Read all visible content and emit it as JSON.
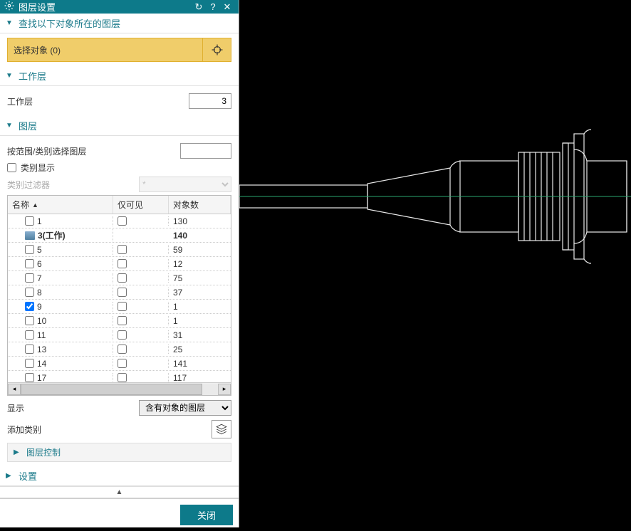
{
  "title_bar": {
    "title": "图层设置"
  },
  "sections": {
    "find": {
      "title": "查找以下对象所在的图层",
      "select_label": "选择对象 (0)"
    },
    "work_layer": {
      "title": "工作层",
      "label": "工作层",
      "value": "3"
    },
    "layers": {
      "title": "图层",
      "range_label": "按范围/类别选择图层",
      "range_value": "",
      "category_display_label": "类别显示",
      "category_filter_label": "类别过滤器",
      "category_filter_value": "*",
      "col_name": "名称",
      "col_visible": "仅可见",
      "col_objects": "对象数",
      "rows": [
        {
          "name": "1",
          "objects": "130",
          "checked": false,
          "work": false
        },
        {
          "name": "3(工作)",
          "objects": "140",
          "checked": false,
          "work": true
        },
        {
          "name": "5",
          "objects": "59",
          "checked": false,
          "work": false
        },
        {
          "name": "6",
          "objects": "12",
          "checked": false,
          "work": false
        },
        {
          "name": "7",
          "objects": "75",
          "checked": false,
          "work": false
        },
        {
          "name": "8",
          "objects": "37",
          "checked": false,
          "work": false
        },
        {
          "name": "9",
          "objects": "1",
          "checked": true,
          "work": false
        },
        {
          "name": "10",
          "objects": "1",
          "checked": false,
          "work": false
        },
        {
          "name": "11",
          "objects": "31",
          "checked": false,
          "work": false
        },
        {
          "name": "13",
          "objects": "25",
          "checked": false,
          "work": false
        },
        {
          "name": "14",
          "objects": "141",
          "checked": false,
          "work": false
        },
        {
          "name": "17",
          "objects": "117",
          "checked": false,
          "work": false
        }
      ],
      "show_label": "显示",
      "show_value": "含有对象的图层",
      "addcat_label": "添加类别",
      "layer_control_label": "图层控制"
    },
    "settings": {
      "title": "设置"
    }
  },
  "footer": {
    "close": "关闭"
  }
}
